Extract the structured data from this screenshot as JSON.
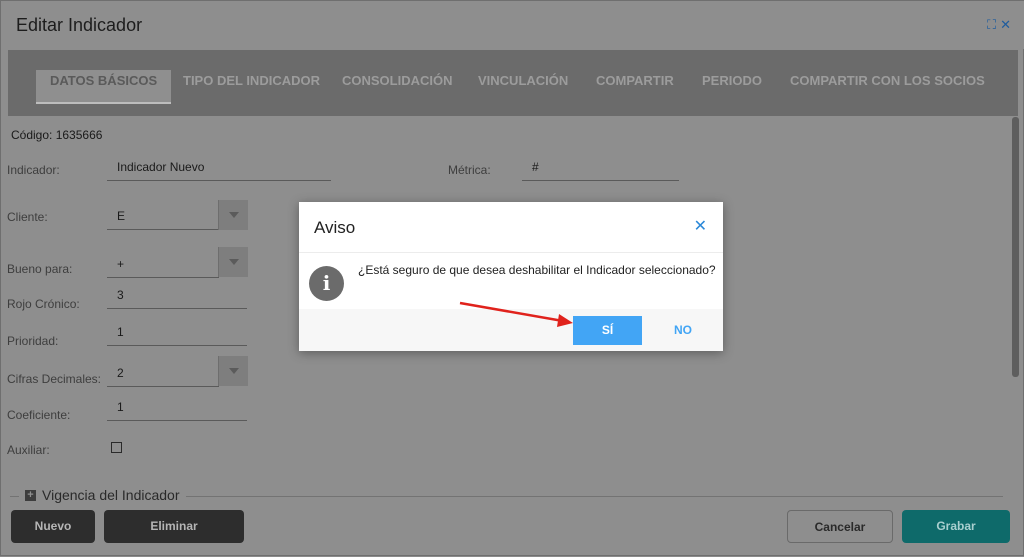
{
  "window": {
    "title": "Editar Indicador",
    "expand_icon": "⛶",
    "close_icon": "✕"
  },
  "tabs": [
    {
      "label": "DATOS BÁSICOS",
      "active": true
    },
    {
      "label": "TIPO DEL INDICADOR"
    },
    {
      "label": "CONSOLIDACIÓN"
    },
    {
      "label": "VINCULACIÓN"
    },
    {
      "label": "COMPARTIR"
    },
    {
      "label": "PERIODO"
    },
    {
      "label": "COMPARTIR CON LOS SOCIOS"
    }
  ],
  "form": {
    "codigo": "Código: 1635666",
    "indicador_label": "Indicador:",
    "indicador_value": "Indicador Nuevo",
    "metrica_label": "Métrica:",
    "metrica_value": "#",
    "cliente_label": "Cliente:",
    "cliente_value": "E",
    "bueno_label": "Bueno para:",
    "bueno_value": "+",
    "rojo_label": "Rojo Crónico:",
    "rojo_value": "3",
    "prioridad_label": "Prioridad:",
    "prioridad_value": "1",
    "cifras_label": "Cifras Decimales:",
    "cifras_value": "2",
    "coef_label": "Coeficiente:",
    "coef_value": "1",
    "auxiliar_label": "Auxiliar:",
    "auxiliar_checked": false,
    "vigencia_title": "Vigencia del Indicador"
  },
  "footer": {
    "nuevo": "Nuevo",
    "eliminar": "Eliminar",
    "cancelar": "Cancelar",
    "grabar": "Grabar"
  },
  "dialog": {
    "title": "Aviso",
    "close_icon": "✕",
    "info_icon": "i",
    "message": "¿Está seguro de que desea deshabilitar el Indicador seleccionado?",
    "yes": "SÍ",
    "no": "NO"
  },
  "colors": {
    "accent_blue": "#42a5f5",
    "grabar": "#0e6a6a",
    "arrow": "#e0221c"
  }
}
